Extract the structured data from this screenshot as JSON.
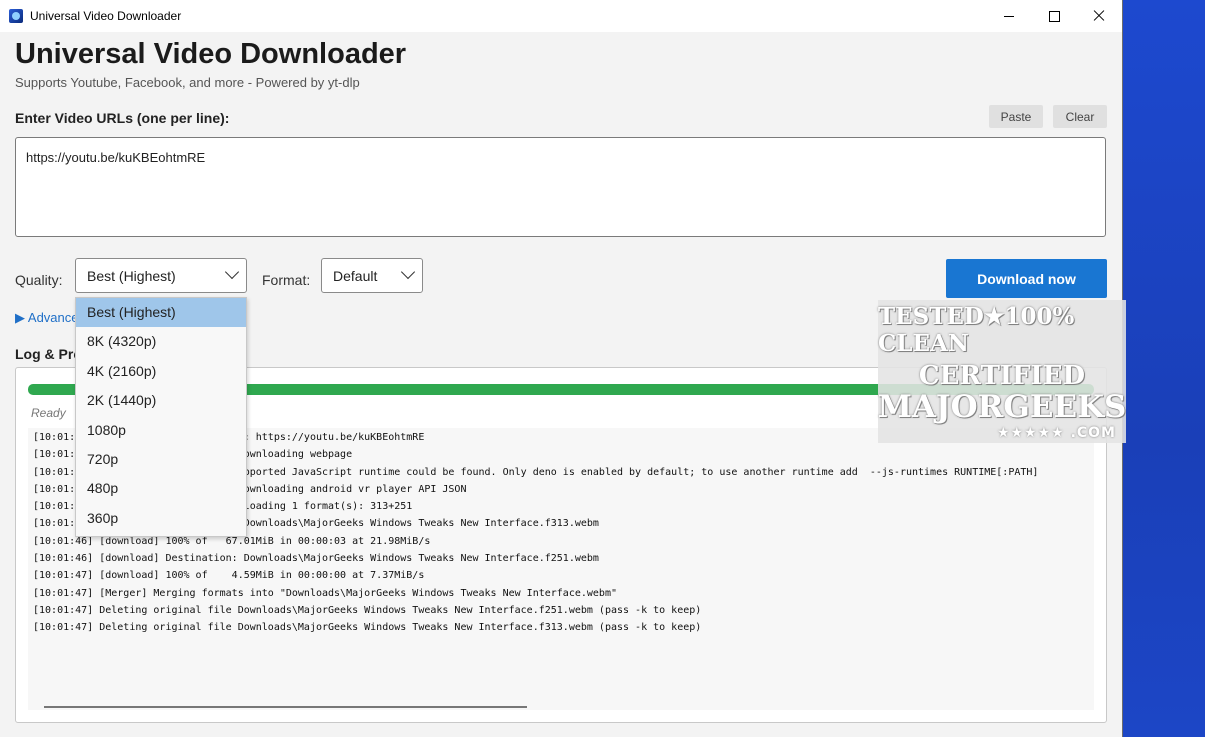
{
  "window": {
    "title": "Universal Video Downloader"
  },
  "header": {
    "title": "Universal Video Downloader",
    "subtitle": "Supports Youtube, Facebook, and more - Powered by yt-dlp"
  },
  "urls": {
    "label": "Enter Video URLs (one per line):",
    "paste_label": "Paste",
    "clear_label": "Clear",
    "value": "https://youtu.be/kuKBEohtmRE"
  },
  "options": {
    "quality_label": "Quality:",
    "quality_value": "Best (Highest)",
    "format_label": "Format:",
    "format_value": "Default",
    "download_label": "Download now",
    "advanced_label": "▶ Advanced"
  },
  "quality_dropdown": {
    "items": [
      "Best (Highest)",
      "8K (4320p)",
      "4K (2160p)",
      "2K (1440p)",
      "1080p",
      "720p",
      "480p",
      "360p"
    ],
    "selected_index": 0
  },
  "log": {
    "label": "Log & Progress",
    "progress_percent": 100,
    "status": "Ready",
    "progress_color": "#2fa84f",
    "lines": [
      "[10:01:46] [youtube] Extracting URL: https://youtu.be/kuKBEohtmRE",
      "[10:01:46] [youtube] kuKBEohtmRE: Downloading webpage",
      "[10:01:46] WARNING: [youtube] No supported JavaScript runtime could be found. Only deno is enabled by default; to use another runtime add  --js-runtimes RUNTIME[:PATH]",
      "[10:01:46] [youtube] kuKBEohtmRE: Downloading android vr player API JSON",
      "[10:01:46] [info] kuKBEohtmRE: Downloading 1 format(s): 313+251",
      "[10:01:46] [download] Destination: Downloads\\MajorGeeks Windows Tweaks New Interface.f313.webm",
      "[10:01:46] [download] 100% of   67.01MiB in 00:00:03 at 21.98MiB/s",
      "[10:01:46] [download] Destination: Downloads\\MajorGeeks Windows Tweaks New Interface.f251.webm",
      "[10:01:47] [download] 100% of    4.59MiB in 00:00:00 at 7.37MiB/s",
      "[10:01:47] [Merger] Merging formats into \"Downloads\\MajorGeeks Windows Tweaks New Interface.webm\"",
      "[10:01:47] Deleting original file Downloads\\MajorGeeks Windows Tweaks New Interface.f251.webm (pass -k to keep)",
      "[10:01:47] Deleting original file Downloads\\MajorGeeks Windows Tweaks New Interface.f313.webm (pass -k to keep)"
    ]
  },
  "watermark": {
    "line1": "TESTED★100% CLEAN",
    "line2": "CERTIFIED",
    "line3": "MAJORGEEKS",
    "line4": "★★★★★ .COM"
  },
  "colors": {
    "accent": "#1976d2",
    "dropdown_selected": "#9fc6ea",
    "desktop": "#1a46c9"
  }
}
